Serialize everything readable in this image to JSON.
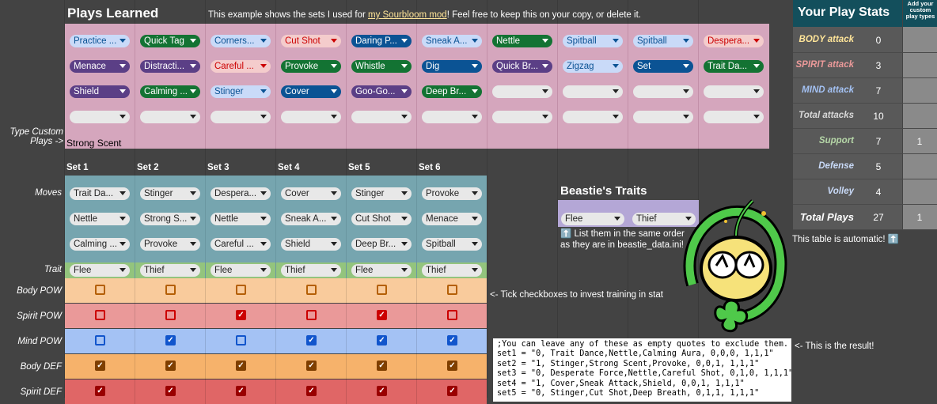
{
  "plays_learned": {
    "title": "Plays Learned",
    "note_prefix": "This example shows the sets I used for ",
    "note_link": "my Sourbloom mod",
    "note_suffix": "! Feel free to keep this on your copy, or delete it.",
    "custom_label_line1": "Type Custom",
    "custom_label_line2": "Plays ->",
    "custom_value": "Strong Scent",
    "rows": [
      [
        [
          "Practice ...",
          "lblue"
        ],
        [
          "Quick Tag",
          "green"
        ],
        [
          "Corners...",
          "lblue"
        ],
        [
          "Cut Shot",
          "red"
        ],
        [
          "Daring P...",
          "dblue"
        ],
        [
          "Sneak A...",
          "lblue"
        ],
        [
          "Nettle",
          "green"
        ],
        [
          "Spitball",
          "lblue"
        ],
        [
          "Spitball",
          "lblue"
        ],
        [
          "Despera...",
          "red"
        ]
      ],
      [
        [
          "Menace",
          "purple"
        ],
        [
          "Distracti...",
          "purple"
        ],
        [
          "Careful ...",
          "red"
        ],
        [
          "Provoke",
          "green"
        ],
        [
          "Whistle",
          "green"
        ],
        [
          "Dig",
          "dblue"
        ],
        [
          "Quick Br...",
          "purple"
        ],
        [
          "Zigzag",
          "lblue"
        ],
        [
          "Set",
          "dblue"
        ],
        [
          "Trait Da...",
          "green"
        ]
      ],
      [
        [
          "Shield",
          "purple"
        ],
        [
          "Calming ...",
          "green"
        ],
        [
          "Stinger",
          "lblue"
        ],
        [
          "Cover",
          "dblue"
        ],
        [
          "Goo-Go...",
          "purple"
        ],
        [
          "Deep Br...",
          "green"
        ],
        [
          "",
          "empty"
        ],
        [
          "",
          "empty"
        ],
        [
          "",
          "empty"
        ],
        [
          "",
          "empty"
        ]
      ],
      [
        [
          "",
          "empty"
        ],
        [
          "",
          "empty"
        ],
        [
          "",
          "empty"
        ],
        [
          "",
          "empty"
        ],
        [
          "",
          "empty"
        ],
        [
          "",
          "empty"
        ],
        [
          "",
          "empty"
        ],
        [
          "",
          "empty"
        ],
        [
          "",
          "empty"
        ],
        [
          "",
          "empty"
        ]
      ]
    ]
  },
  "sets": {
    "headers": [
      "Set 1",
      "Set 2",
      "Set 3",
      "Set 4",
      "Set 5",
      "Set 6"
    ],
    "moves_label": "Moves",
    "trait_label": "Trait",
    "moves": [
      [
        "Trait Da...",
        "Stinger",
        "Despera...",
        "Cover",
        "Stinger",
        "Provoke"
      ],
      [
        "Nettle",
        "Strong S...",
        "Nettle",
        "Sneak A...",
        "Cut Shot",
        "Menace"
      ],
      [
        "Calming ...",
        "Provoke",
        "Careful ...",
        "Shield",
        "Deep Br...",
        "Spitball"
      ]
    ],
    "traits": [
      "Flee",
      "Thief",
      "Flee",
      "Thief",
      "Flee",
      "Thief"
    ],
    "stat_rows": [
      {
        "label": "Body POW",
        "checked": [
          false,
          false,
          false,
          false,
          false,
          false
        ]
      },
      {
        "label": "Spirit POW",
        "checked": [
          false,
          false,
          true,
          false,
          true,
          false
        ]
      },
      {
        "label": "Mind POW",
        "checked": [
          false,
          true,
          false,
          true,
          true,
          true
        ]
      },
      {
        "label": "Body DEF",
        "checked": [
          true,
          true,
          true,
          true,
          true,
          true
        ]
      },
      {
        "label": "Spirit DEF",
        "checked": [
          true,
          true,
          true,
          true,
          true,
          true
        ]
      }
    ],
    "checkbox_note": "<- Tick checkboxes to invest training in stat"
  },
  "traits_box": {
    "title": "Beastie's Traits",
    "values": [
      "Flee",
      "Thief"
    ],
    "note_line1": "⬆️ List them in the same order",
    "note_line2": "as they are in beastie_data.ini!"
  },
  "stats": {
    "title": "Your Play Stats",
    "extra_header": "Add your custom play types",
    "rows": [
      {
        "label": "BODY attack",
        "value": "0",
        "extra": "",
        "color": "#ffe599"
      },
      {
        "label": "SPIRIT attack",
        "value": "3",
        "extra": "",
        "color": "#ea9999"
      },
      {
        "label": "MIND attack",
        "value": "7",
        "extra": "",
        "color": "#a4c2f4"
      },
      {
        "label": "Total attacks",
        "value": "10",
        "extra": "",
        "color": "#d9d9d9"
      },
      {
        "label": "Support",
        "value": "7",
        "extra": "1",
        "color": "#b6d7a8"
      },
      {
        "label": "Defense",
        "value": "5",
        "extra": "",
        "color": "#c9daf8"
      },
      {
        "label": "Volley",
        "value": "4",
        "extra": "",
        "color": "#c9daf8"
      },
      {
        "label": "Total Plays",
        "value": "27",
        "extra": "1",
        "color": "#ffffff"
      }
    ],
    "auto_note": "This table is automatic! ⬆️"
  },
  "result": {
    "arrow_note": "<- This is the result!",
    "code_lines": [
      ";You can leave any of these as empty quotes to exclude them.",
      "set1 = \"0, Trait Dance,Nettle,Calming Aura, 0,0,0, 1,1,1\"",
      "set2 = \"1, Stinger,Strong Scent,Provoke, 0,0,1, 1,1,1\"",
      "set3 = \"0, Desperate Force,Nettle,Careful Shot, 0,1,0, 1,1,1\"",
      "set4 = \"1, Cover,Sneak Attack,Shield, 0,0,1, 1,1,1\"",
      "set5 = \"0, Stinger,Cut Shot,Deep Breath, 0,1,1, 1,1,1\""
    ]
  },
  "colors": {
    "pink": "#d5a6bd",
    "teal": "#76a5af",
    "green": "#93c47d",
    "body_pow": "#f9cb9c",
    "spirit_pow": "#ea9999",
    "mind_pow": "#a4c2f4",
    "body_def": "#f6b26b",
    "spirit_def": "#e06666"
  }
}
